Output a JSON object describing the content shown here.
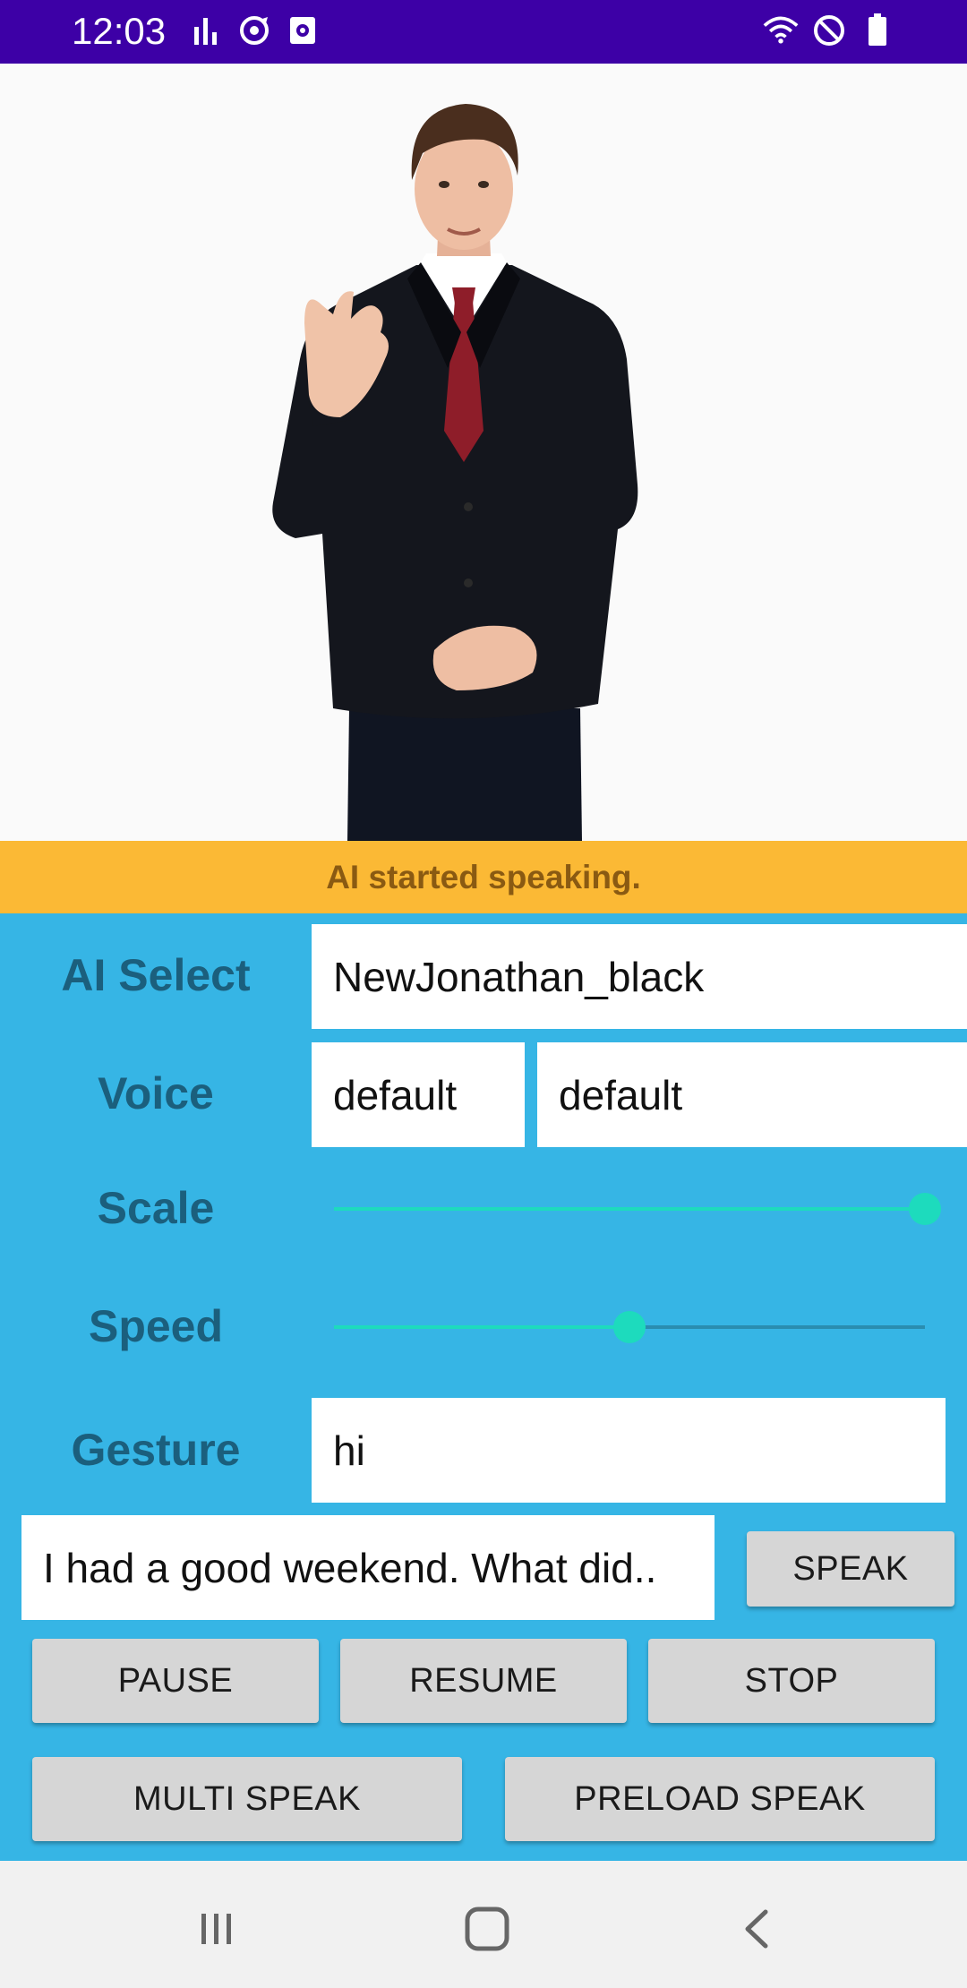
{
  "status_bar": {
    "time": "12:03",
    "left_icons": [
      "signal-bars-icon",
      "sync-icon",
      "screen-record-icon"
    ],
    "right_icons": [
      "wifi-icon",
      "do-not-disturb-icon",
      "battery-icon"
    ]
  },
  "status_message": "AI started speaking.",
  "ai_select": {
    "label": "AI Select",
    "value": "NewJonathan_black"
  },
  "voice": {
    "label": "Voice",
    "value1": "default",
    "value2": "default"
  },
  "scale": {
    "label": "Scale",
    "level_fraction": 1.0
  },
  "speed": {
    "label": "Speed",
    "level_fraction": 0.5
  },
  "gesture": {
    "label": "Gesture",
    "value": "hi"
  },
  "speak_text": "I had a good weekend. What did..",
  "buttons": {
    "speak": "SPEAK",
    "pause": "PAUSE",
    "resume": "RESUME",
    "stop": "STOP",
    "multi_speak": "MULTI SPEAK",
    "preload_speak": "PRELOAD SPEAK"
  },
  "nav_icons": [
    "recent-apps-icon",
    "home-icon",
    "back-icon"
  ],
  "colors": {
    "status_bar": "#3d00a6",
    "status_message_bg": "#fbb935",
    "panel_bg": "#36b5e5",
    "label_text": "#1b5f7d",
    "slider_accent": "#1ddbbd"
  }
}
